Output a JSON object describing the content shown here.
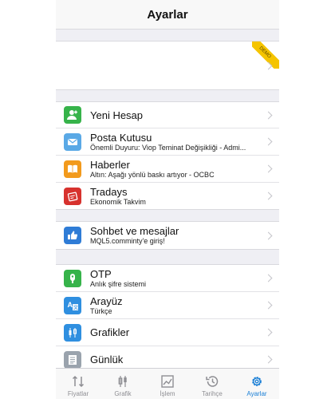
{
  "header": {
    "title": "Ayarlar"
  },
  "account": {
    "badge": "DEMO"
  },
  "section1": [
    {
      "label": "Yeni Hesap",
      "sub": "",
      "icon": "add-user-icon",
      "color": "#36b34a"
    },
    {
      "label": "Posta Kutusu",
      "sub": "Önemli Duyuru: Viop Teminat Değişikliği - Admi...",
      "icon": "mail-icon",
      "color": "#5aa9e6"
    },
    {
      "label": "Haberler",
      "sub": "Altın: Aşağı yönlü baskı artıyor - OCBC",
      "icon": "book-icon",
      "color": "#f29a1c"
    },
    {
      "label": "Tradays",
      "sub": "Ekonomik Takvim",
      "icon": "calendar-icon",
      "color": "#d7322e"
    }
  ],
  "section2": [
    {
      "label": "Sohbet ve mesajlar",
      "sub": "MQL5.comminty'e giriş!",
      "icon": "thumbs-up-icon",
      "color": "#2f7cd6"
    }
  ],
  "section3": [
    {
      "label": "OTP",
      "sub": "Anlık şifre sistemi",
      "icon": "key-icon",
      "color": "#36b34a"
    },
    {
      "label": "Arayüz",
      "sub": "Türkçe",
      "icon": "translate-icon",
      "color": "#2f8fe0"
    },
    {
      "label": "Grafikler",
      "sub": "",
      "icon": "candlestick-icon",
      "color": "#2f8fe0"
    },
    {
      "label": "Günlük",
      "sub": "",
      "icon": "journal-icon",
      "color": "#9aa3ad"
    }
  ],
  "tabbar": [
    {
      "label": "Fiyatlar",
      "icon": "quotes-icon",
      "active": false
    },
    {
      "label": "Grafik",
      "icon": "chart-icon",
      "active": false
    },
    {
      "label": "İşlem",
      "icon": "trade-icon",
      "active": false
    },
    {
      "label": "Tarihçe",
      "icon": "history-icon",
      "active": false
    },
    {
      "label": "Ayarlar",
      "icon": "settings-icon",
      "active": true
    }
  ],
  "colors": {
    "accent": "#1a7fd6",
    "inactive": "#8e8e93",
    "ribbon": "#f5c400"
  }
}
